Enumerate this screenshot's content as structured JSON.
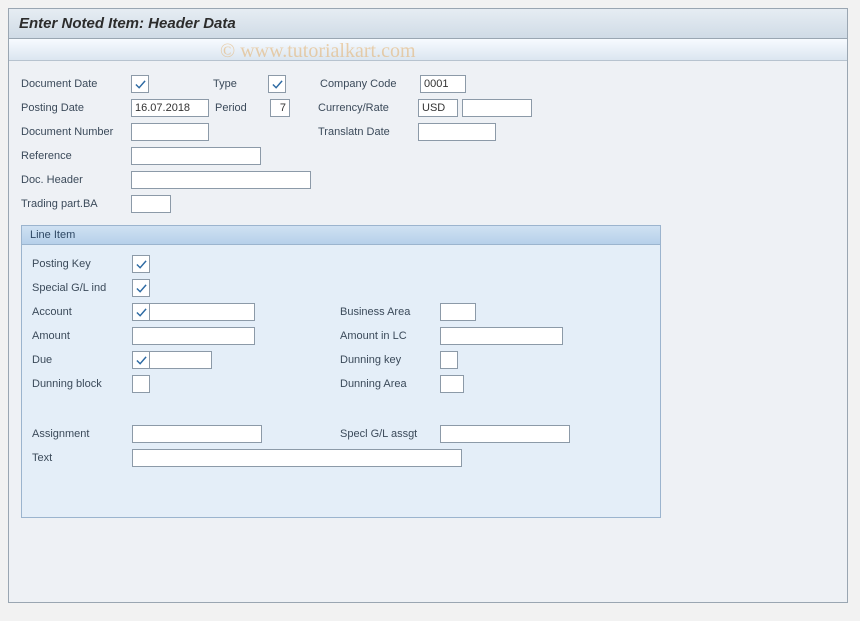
{
  "title": "Enter Noted Item: Header Data",
  "watermark": "© www.tutorialkart.com",
  "header": {
    "document_date": {
      "label": "Document Date",
      "value": "",
      "required": true
    },
    "posting_date": {
      "label": "Posting Date",
      "value": "16.07.2018"
    },
    "document_number": {
      "label": "Document Number",
      "value": ""
    },
    "reference": {
      "label": "Reference",
      "value": ""
    },
    "doc_header": {
      "label": "Doc. Header",
      "value": ""
    },
    "trading_part_ba": {
      "label": "Trading part.BA",
      "value": ""
    },
    "type": {
      "label": "Type",
      "value": "",
      "required": true
    },
    "period": {
      "label": "Period",
      "value": "7"
    },
    "company_code": {
      "label": "Company Code",
      "value": "0001"
    },
    "currency_rate": {
      "label": "Currency/Rate",
      "value": "USD",
      "value2": ""
    },
    "translatn_date": {
      "label": "Translatn Date",
      "value": ""
    }
  },
  "line_item": {
    "title": "Line Item",
    "posting_key": {
      "label": "Posting Key",
      "value": "",
      "required": true
    },
    "special_gl_ind": {
      "label": "Special G/L ind",
      "value": "",
      "required": true
    },
    "account": {
      "label": "Account",
      "value": "",
      "required": true
    },
    "amount": {
      "label": "Amount",
      "value": ""
    },
    "due": {
      "label": "Due",
      "value": "",
      "required": true
    },
    "dunning_block": {
      "label": "Dunning block",
      "value": ""
    },
    "business_area": {
      "label": "Business Area",
      "value": ""
    },
    "amount_in_lc": {
      "label": "Amount in LC",
      "value": ""
    },
    "dunning_key": {
      "label": "Dunning key",
      "value": ""
    },
    "dunning_area": {
      "label": "Dunning Area",
      "value": ""
    },
    "assignment": {
      "label": "Assignment",
      "value": ""
    },
    "specl_gl_assgt": {
      "label": "Specl G/L assgt",
      "value": ""
    },
    "text": {
      "label": "Text",
      "value": ""
    }
  }
}
